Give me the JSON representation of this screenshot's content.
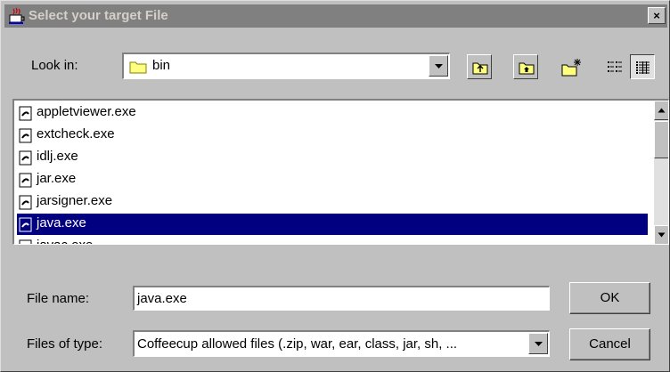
{
  "window": {
    "title": "Select your target File",
    "close_label": "×"
  },
  "toolbar": {
    "lookin_label": "Look in:",
    "lookin_value": "bin",
    "buttons": [
      "up-one-level",
      "home",
      "new-folder",
      "list-view",
      "details-view"
    ]
  },
  "files": [
    {
      "name": "appletviewer.exe",
      "selected": false
    },
    {
      "name": "extcheck.exe",
      "selected": false
    },
    {
      "name": "idlj.exe",
      "selected": false
    },
    {
      "name": "jar.exe",
      "selected": false
    },
    {
      "name": "jarsigner.exe",
      "selected": false
    },
    {
      "name": "java.exe",
      "selected": true
    },
    {
      "name": "javac.exe",
      "selected": false
    }
  ],
  "form": {
    "filename_label": "File name:",
    "filename_value": "java.exe",
    "filetype_label": "Files of type:",
    "filetype_value": "Coffeecup allowed files (.zip, war, ear, class, jar, sh, ..."
  },
  "buttons": {
    "ok_label": "OK",
    "cancel_label": "Cancel"
  },
  "colors": {
    "window_bg": "#c0c0c0",
    "titlebar_inactive": "#808080",
    "selection": "#000080"
  }
}
